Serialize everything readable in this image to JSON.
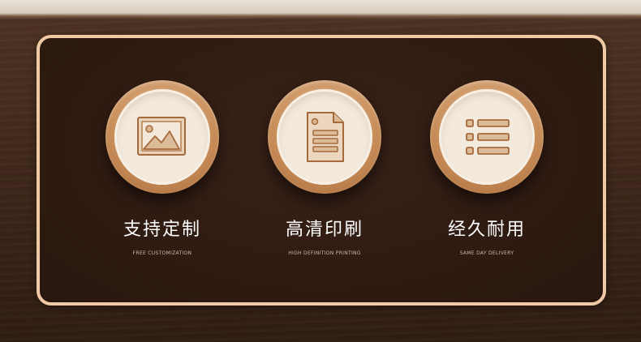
{
  "features": [
    {
      "title": "支持定制",
      "subtitle": "FREE CUSTOMIZATION",
      "icon": "image-icon"
    },
    {
      "title": "高清印刷",
      "subtitle": "HIGH DEFINITION PRINTING",
      "icon": "document-icon"
    },
    {
      "title": "经久耐用",
      "subtitle": "SAME DAY DELIVERY",
      "icon": "list-icon"
    }
  ],
  "colors": {
    "panel_border": "#f0c9a5",
    "panel_bg": "#2e1a11",
    "ring": "#c98f5b",
    "icon_fill": "#e3c4a4",
    "icon_stroke": "#a56a3c"
  }
}
